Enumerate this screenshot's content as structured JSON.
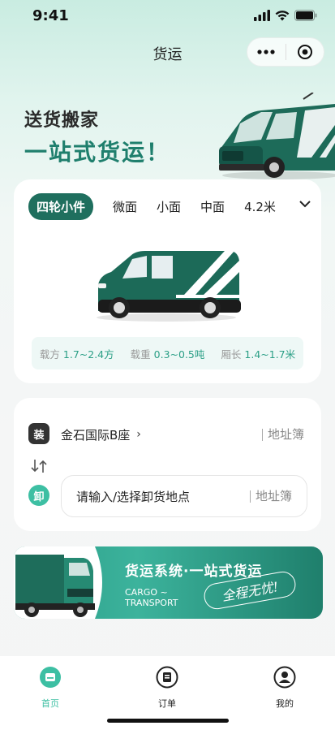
{
  "status": {
    "time": "9:41"
  },
  "nav": {
    "title": "货运"
  },
  "hero": {
    "line1": "送货搬家",
    "line2": "一站式货运！"
  },
  "vehicle_tabs": [
    "四轮小件",
    "微面",
    "小面",
    "中面",
    "4.2米"
  ],
  "specs": [
    {
      "label": "载方",
      "value": "1.7~2.4方"
    },
    {
      "label": "载重",
      "value": "0.3~0.5吨"
    },
    {
      "label": "厢长",
      "value": "1.4~1.7米"
    }
  ],
  "address": {
    "load_badge": "装",
    "unload_badge": "卸",
    "pickup": "金石国际B座",
    "pickup_arrow": "›",
    "dropoff_placeholder": "请输入/选择卸货地点",
    "address_book": "地址簿"
  },
  "banner": {
    "title": "货运系统·一站式货运",
    "en1": "CARGO ~",
    "en2": "TRANSPORT",
    "slogan": "全程无忧!"
  },
  "tabbar": [
    {
      "label": "首页",
      "active": true
    },
    {
      "label": "订单",
      "active": false
    },
    {
      "label": "我的",
      "active": false
    }
  ],
  "colors": {
    "primary": "#1f6f5e",
    "accent": "#3dbfa3",
    "spec_value": "#2b9f86"
  }
}
